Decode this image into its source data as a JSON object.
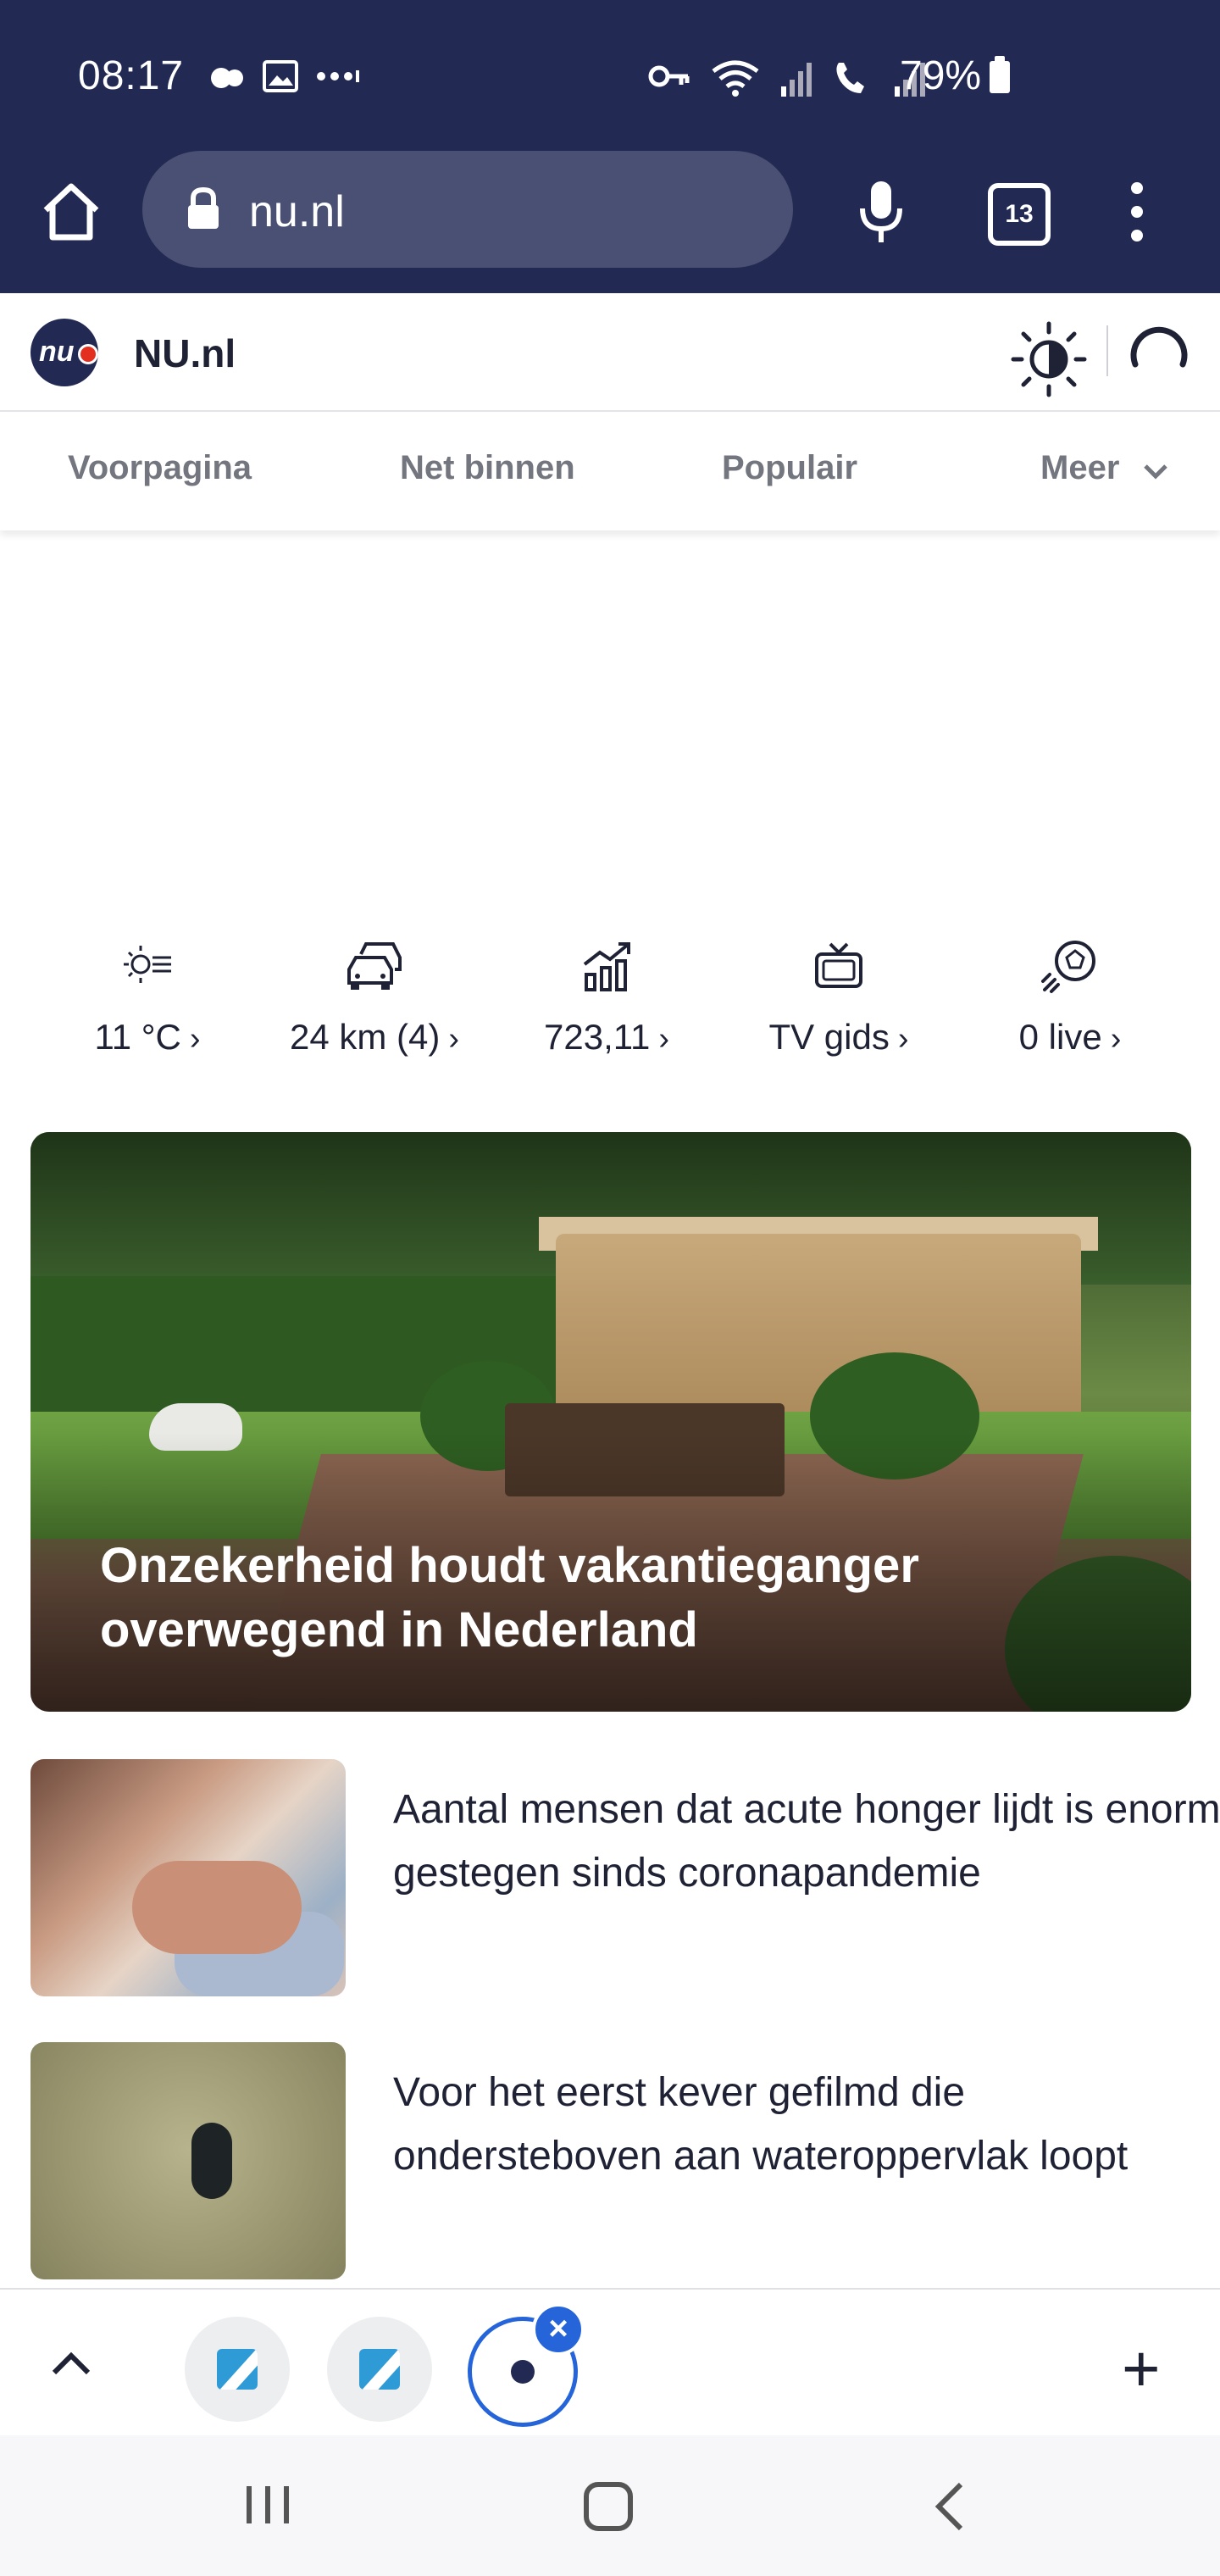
{
  "status_bar": {
    "time": "08:17",
    "battery": "79%",
    "icons": [
      "carrier-icon",
      "image-icon",
      "more-dots-icon",
      "key-icon",
      "wifi-icon",
      "signal-icon",
      "volte-icon",
      "signal-icon",
      "battery-icon"
    ]
  },
  "browser": {
    "url": "nu.nl",
    "tab_count": "13"
  },
  "site": {
    "name": "NU.nl",
    "logo_text": "nu"
  },
  "nav": {
    "items": [
      "Voorpagina",
      "Net binnen",
      "Populair",
      "Meer"
    ]
  },
  "widgets": [
    {
      "icon": "weather-icon",
      "label": "11 °C"
    },
    {
      "icon": "traffic-icon",
      "label": "24 km (4)"
    },
    {
      "icon": "stocks-icon",
      "label": "723,11"
    },
    {
      "icon": "tv-icon",
      "label": "TV gids"
    },
    {
      "icon": "football-icon",
      "label": "0 live"
    }
  ],
  "hero": {
    "title": "Onzekerheid houdt vakantieganger overwegend in Nederland"
  },
  "articles": [
    {
      "headline": "Aantal mensen dat acute honger lijdt is enorm gestegen sinds coronapandemie"
    },
    {
      "headline": "Voor het eerst kever gefilmd die ondersteboven aan wateroppervlak loopt"
    }
  ],
  "tabstrip": {
    "close_symbol": "×",
    "add_symbol": "+"
  },
  "colors": {
    "chrome": "#222a54",
    "accent": "#2565d9",
    "nav_text": "#74767f"
  }
}
